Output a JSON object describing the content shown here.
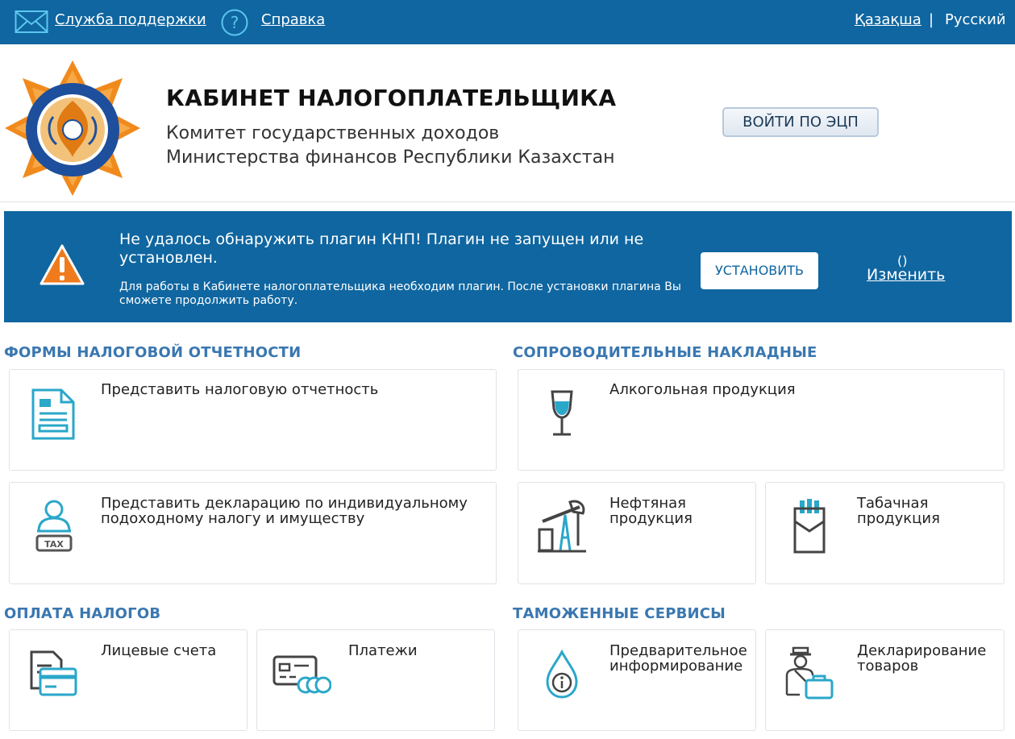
{
  "topbar": {
    "support_label": "Служба поддержки",
    "help_label": "Справка",
    "lang_kz": "Қазақша",
    "lang_sep": "|",
    "lang_ru": "Русский"
  },
  "header": {
    "title": "КАБИНЕТ НАЛОГОПЛАТЕЛЬЩИКА",
    "subtitle_line1": "Комитет государственных доходов",
    "subtitle_line2": "Министерства финансов Республики Казахстан",
    "login_button": "ВОЙТИ ПО ЭЦП"
  },
  "alert": {
    "title": "Не удалось обнаружить плагин КНП! Плагин не запущен или не установлен.",
    "text": "Для работы в Кабинете налогоплательщика необходим плагин. После установки плагина Вы сможете продолжить работу.",
    "install_button": "УСТАНОВИТЬ",
    "paren": "()",
    "change_link": "Изменить"
  },
  "sections": {
    "tax_forms": {
      "title": "ФОРМЫ НАЛОГОВОЙ ОТЧЕТНОСТИ",
      "card1": "Представить налоговую отчетность",
      "card2": "Представить декларацию по индивидуальному подоходному налогу и имуществу"
    },
    "waybills": {
      "title": "СОПРОВОДИТЕЛЬНЫЕ НАКЛАДНЫЕ",
      "alcohol": "Алкогольная продукция",
      "oil": "Нефтяная продукция",
      "tobacco": "Табачная продукция"
    },
    "payments": {
      "title": "ОПЛАТА НАЛОГОВ",
      "accounts": "Лицевые счета",
      "payments": "Платежи"
    },
    "customs": {
      "title": "ТАМОЖЕННЫЕ СЕРВИСЫ",
      "preinfo": "Предварительное информирование",
      "declaring": "Декларирование товаров"
    }
  },
  "colors": {
    "brand_blue": "#0f66a0",
    "section_title": "#3a77b0",
    "icon_accent": "#2aa7c9"
  }
}
